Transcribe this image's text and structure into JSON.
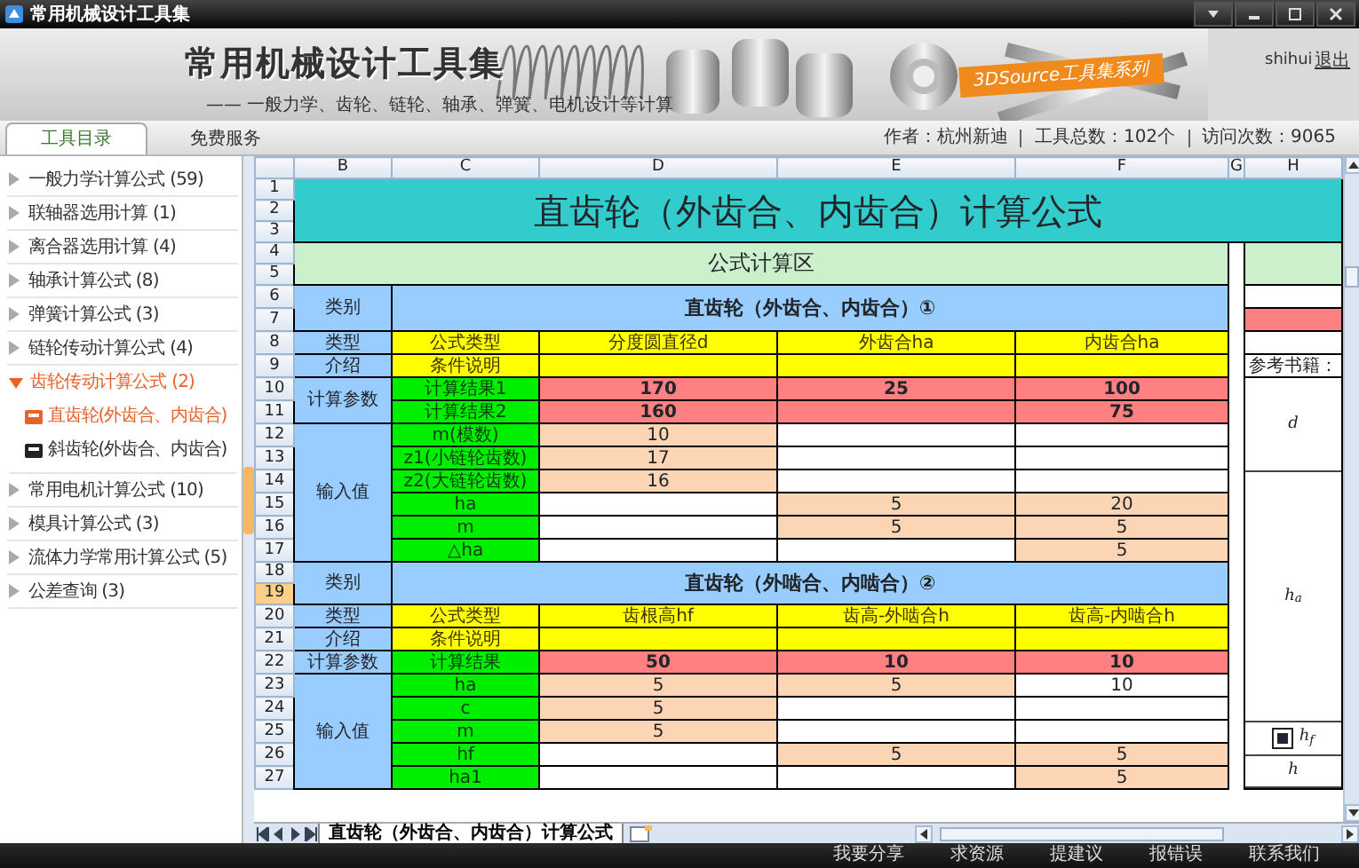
{
  "window": {
    "title": "常用机械设计工具集"
  },
  "banner": {
    "title": "常用机械设计工具集",
    "subtitle": "—— 一般力学、齿轮、链轮、轴承、弹簧、电机设计等计算",
    "ribbon": "3DSource工具集系列",
    "user": "shihui",
    "logout": "退出"
  },
  "tabs": [
    {
      "label": "工具目录",
      "selected": true
    },
    {
      "label": "免费服务",
      "selected": false
    }
  ],
  "info": [
    "作者：杭州新迪",
    "工具总数：102个",
    "访问次数：9065"
  ],
  "sidebar": {
    "items": [
      {
        "label": "一般力学计算公式 (59)",
        "expanded": false
      },
      {
        "label": "联轴器选用计算 (1)",
        "expanded": false
      },
      {
        "label": "离合器选用计算 (4)",
        "expanded": false
      },
      {
        "label": "轴承计算公式 (8)",
        "expanded": false
      },
      {
        "label": "弹簧计算公式 (3)",
        "expanded": false
      },
      {
        "label": "链轮传动计算公式 (4)",
        "expanded": false
      },
      {
        "label": "齿轮传动计算公式 (2)",
        "expanded": true,
        "children": [
          {
            "label": "直齿轮(外齿合、内齿合)",
            "selected": true
          },
          {
            "label": "斜齿轮(外齿合、内齿合)",
            "selected": false
          }
        ]
      },
      {
        "label": "常用电机计算公式 (10)",
        "expanded": false
      },
      {
        "label": "模具计算公式 (3)",
        "expanded": false
      },
      {
        "label": "流体力学常用计算公式 (5)",
        "expanded": false
      },
      {
        "label": "公差查询 (3)",
        "expanded": false
      }
    ]
  },
  "sheet": {
    "columns": [
      "B",
      "C",
      "D",
      "E",
      "F",
      "G",
      "H"
    ],
    "rows": [
      {
        "label": "1",
        "selected": false
      },
      {
        "label": "2",
        "selected": false
      },
      {
        "label": "3",
        "selected": false
      },
      {
        "label": "4",
        "selected": false
      },
      {
        "label": "5",
        "selected": false
      },
      {
        "label": "6",
        "selected": false
      },
      {
        "label": "7",
        "selected": false
      },
      {
        "label": "8",
        "selected": false
      },
      {
        "label": "9",
        "selected": false
      },
      {
        "label": "10",
        "selected": false
      },
      {
        "label": "11",
        "selected": false
      },
      {
        "label": "12",
        "selected": false
      },
      {
        "label": "13",
        "selected": false
      },
      {
        "label": "14",
        "selected": false
      },
      {
        "label": "15",
        "selected": false
      },
      {
        "label": "16",
        "selected": false
      },
      {
        "label": "17",
        "selected": false
      },
      {
        "label": "18",
        "selected": false
      },
      {
        "label": "19",
        "selected": true
      },
      {
        "label": "20",
        "selected": false
      },
      {
        "label": "21",
        "selected": false
      },
      {
        "label": "22",
        "selected": false
      },
      {
        "label": "23",
        "selected": false
      },
      {
        "label": "24",
        "selected": false
      },
      {
        "label": "25",
        "selected": false
      },
      {
        "label": "26",
        "selected": false
      },
      {
        "label": "27",
        "selected": false
      }
    ],
    "title": "直齿轮（外齿合、内齿合）计算公式",
    "area_title": "公式计算区",
    "sections": [
      {
        "category_label": "类别",
        "name": "直齿轮（外齿合、内齿合）①",
        "type_label": "类型",
        "formula_label": "公式类型",
        "formulas": [
          "分度圆直径d",
          "外齿合ha",
          "内齿合ha"
        ],
        "intro_label": "介绍",
        "condition_label": "条件说明",
        "params_label": "计算参数",
        "results": [
          {
            "label": "计算结果1",
            "values": [
              {
                "text": "170"
              },
              {
                "text": "25"
              },
              {
                "text": "100"
              }
            ]
          },
          {
            "label": "计算结果2",
            "values": [
              {
                "text": "160"
              },
              {
                "kind": "empty"
              },
              {
                "text": "75"
              }
            ]
          }
        ],
        "inputs_label": "输入值",
        "inputs": [
          {
            "label": "m(模数)",
            "values": [
              {
                "text": "10",
                "kind": "input"
              },
              {
                "kind": "blank"
              },
              {
                "kind": "blank"
              }
            ]
          },
          {
            "label": "z1(小链轮齿数)",
            "values": [
              {
                "text": "17",
                "kind": "input"
              },
              {
                "kind": "blank"
              },
              {
                "kind": "blank"
              }
            ]
          },
          {
            "label": "z2(大链轮齿数)",
            "values": [
              {
                "text": "16",
                "kind": "input"
              },
              {
                "kind": "blank"
              },
              {
                "kind": "blank"
              }
            ]
          },
          {
            "label": "ha",
            "values": [
              {
                "kind": "blank"
              },
              {
                "text": "5",
                "kind": "input"
              },
              {
                "text": "20",
                "kind": "input"
              }
            ]
          },
          {
            "label": "m",
            "values": [
              {
                "kind": "blank"
              },
              {
                "text": "5",
                "kind": "input"
              },
              {
                "text": "5",
                "kind": "input"
              }
            ]
          },
          {
            "label": "△ha",
            "values": [
              {
                "kind": "blank"
              },
              {
                "kind": "blank"
              },
              {
                "text": "5",
                "kind": "input"
              }
            ]
          }
        ]
      },
      {
        "category_label": "类别",
        "name": "直齿轮（外啮合、内啮合）②",
        "type_label": "类型",
        "formula_label": "公式类型",
        "formulas": [
          "齿根高hf",
          "齿高-外啮合h",
          "齿高-内啮合h"
        ],
        "intro_label": "介绍",
        "condition_label": "条件说明",
        "params_label": "计算参数",
        "results": [
          {
            "label": "计算结果",
            "values": [
              {
                "text": "50"
              },
              {
                "text": "10"
              },
              {
                "text": "10"
              }
            ]
          }
        ],
        "inputs_label": "输入值",
        "inputs": [
          {
            "label": "ha",
            "values": [
              {
                "text": "5",
                "kind": "input"
              },
              {
                "text": "5",
                "kind": "input"
              },
              {
                "text": "10",
                "kind": "plain"
              }
            ]
          },
          {
            "label": "c",
            "values": [
              {
                "text": "5",
                "kind": "input"
              },
              {
                "kind": "blank"
              },
              {
                "kind": "blank"
              }
            ]
          },
          {
            "label": "m",
            "values": [
              {
                "text": "5",
                "kind": "input"
              },
              {
                "kind": "blank"
              },
              {
                "kind": "blank"
              }
            ]
          },
          {
            "label": "hf",
            "values": [
              {
                "kind": "blank"
              },
              {
                "text": "5",
                "kind": "input"
              },
              {
                "text": "5",
                "kind": "input"
              }
            ]
          },
          {
            "label": "ha1",
            "values": [
              {
                "kind": "blank"
              },
              {
                "kind": "blank"
              },
              {
                "text": "5",
                "kind": "input"
              }
            ]
          }
        ]
      }
    ],
    "reference": {
      "label": "参考书籍：",
      "figure_labels": [
        "d",
        "h$_{a}$",
        "h$_{f}$",
        "h"
      ]
    },
    "sheet_tabs": [
      {
        "label": "直齿轮（外齿合、内齿合）计算公式",
        "selected": true
      }
    ]
  },
  "footer": [
    "我要分享",
    "求资源",
    "提建议",
    "报错误",
    "联系我们"
  ]
}
